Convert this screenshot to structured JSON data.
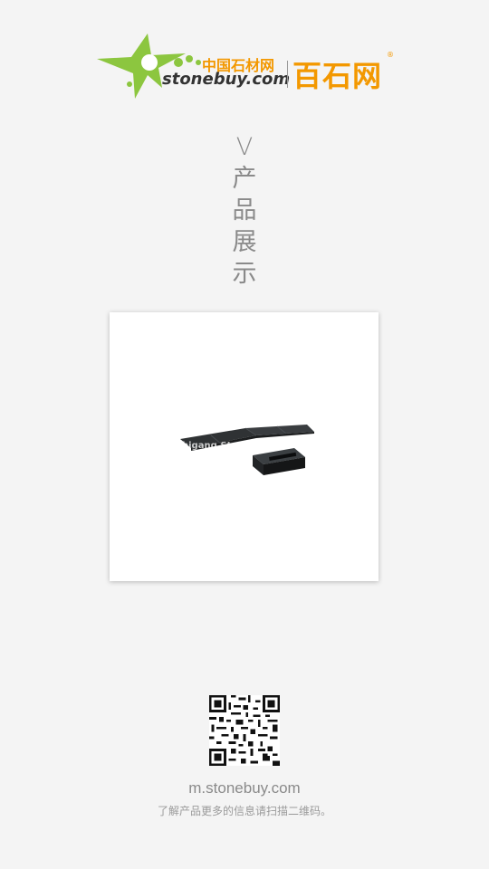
{
  "logo": {
    "cn_site_name": "中国石材网",
    "domain": "stonebuy.com",
    "brand": "百石网",
    "reg_mark": "®",
    "colors": {
      "green": "#8cc63f",
      "orange": "#f39800",
      "dark": "#333333"
    }
  },
  "title": {
    "chars": [
      "V",
      "产",
      "品",
      "展",
      "示"
    ]
  },
  "product": {
    "watermark": "higang.Stonebuy",
    "image_icon": "stone-slab-product-image"
  },
  "footer": {
    "qr_icon": "qr-code-icon",
    "url": "m.stonebuy.com",
    "hint": "了解产品更多的信息请扫描二维码。"
  }
}
